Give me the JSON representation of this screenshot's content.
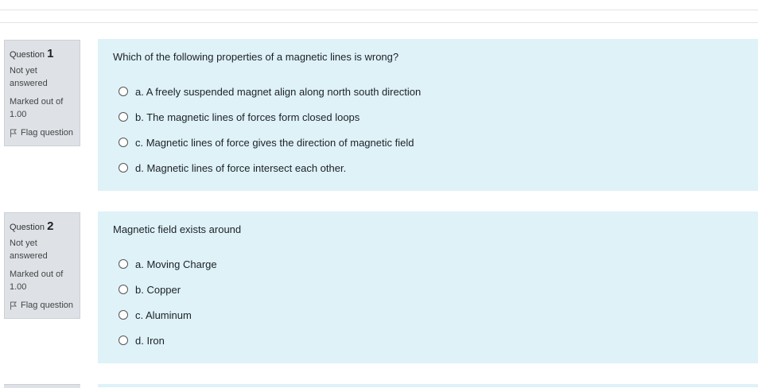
{
  "questions": [
    {
      "label": "Question",
      "number": "1",
      "state": "Not yet answered",
      "grade": "Marked out of 1.00",
      "flag_label": "Flag question",
      "text": "Which of the following properties of a magnetic lines is wrong?",
      "options": [
        "a. A freely suspended magnet align along north south direction",
        "b. The magnetic lines of forces form closed loops",
        "c. Magnetic lines of force gives the direction of magnetic field",
        "d. Magnetic lines of force intersect each other."
      ]
    },
    {
      "label": "Question",
      "number": "2",
      "state": "Not yet answered",
      "grade": "Marked out of 1.00",
      "flag_label": "Flag question",
      "text": "Magnetic field exists around",
      "options": [
        "a. Moving Charge",
        "b. Copper",
        "c. Aluminum",
        "d. Iron"
      ]
    }
  ],
  "colors": {
    "info_bg": "#dee2e6",
    "question_bg": "#def2f8",
    "text": "#1d2125"
  },
  "icons": {
    "flag": "flag-icon",
    "radio": "radio-button"
  }
}
